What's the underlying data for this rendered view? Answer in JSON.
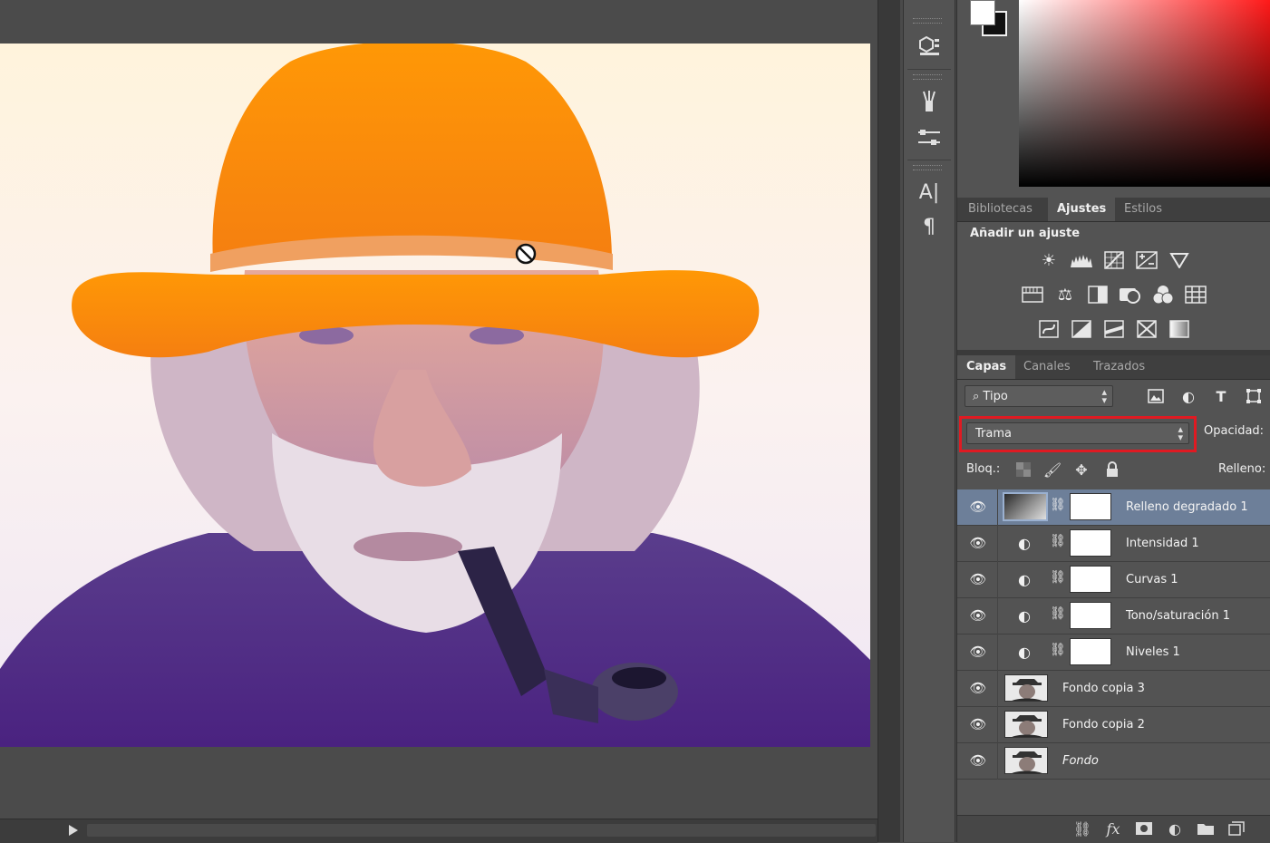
{
  "tabs_top": {
    "libraries": "Bibliotecas",
    "adjustments": "Ajustes",
    "styles": "Estilos"
  },
  "adjustments": {
    "title": "Añadir un ajuste"
  },
  "tabs_layers": {
    "layers": "Capas",
    "channels": "Canales",
    "paths": "Trazados"
  },
  "layers_panel": {
    "kind_filter": "Tipo",
    "blend_mode": "Trama",
    "opacity_label": "Opacidad:",
    "lock_label": "Bloq.:",
    "fill_label": "Relleno:"
  },
  "layers": [
    {
      "name": "Relleno degradado 1",
      "kind": "gradient",
      "selected": true
    },
    {
      "name": "Intensidad 1",
      "kind": "adjustment"
    },
    {
      "name": "Curvas 1",
      "kind": "adjustment"
    },
    {
      "name": "Tono/saturación 1",
      "kind": "adjustment"
    },
    {
      "name": "Niveles 1",
      "kind": "adjustment"
    },
    {
      "name": "Fondo copia 3",
      "kind": "pixel"
    },
    {
      "name": "Fondo copia 2",
      "kind": "pixel"
    },
    {
      "name": "Fondo",
      "kind": "pixel",
      "italic": true
    }
  ],
  "colors": {
    "foreground": "#ffffff",
    "background": "#111111",
    "selection_highlight": "#e01a22",
    "gradient_top": "#ff9a10",
    "gradient_bottom": "#6a2fa0"
  }
}
